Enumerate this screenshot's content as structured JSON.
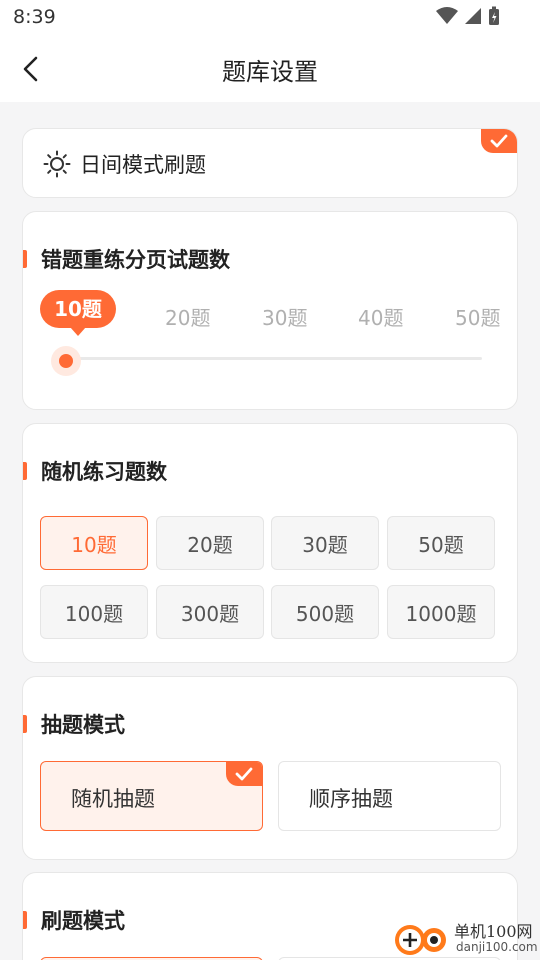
{
  "status": {
    "time": "8:39"
  },
  "header": {
    "title": "题库设置"
  },
  "day_mode": {
    "label": "日间模式刷题"
  },
  "wrong_page": {
    "title": "错题重练分页试题数",
    "options": [
      "10题",
      "20题",
      "30题",
      "40题",
      "50题"
    ],
    "selected": "10题"
  },
  "random_practice": {
    "title": "随机练习题数",
    "options": [
      "10题",
      "20题",
      "30题",
      "50题",
      "100题",
      "300题",
      "500题",
      "1000题"
    ],
    "selected": "10题"
  },
  "draw_mode": {
    "title": "抽题模式",
    "options": [
      "随机抽题",
      "顺序抽题"
    ],
    "selected": "随机抽题"
  },
  "brush_mode": {
    "title": "刷题模式"
  },
  "watermark": {
    "cn": "单机100网",
    "en": "danji100.com"
  },
  "colors": {
    "accent": "#ff6a35",
    "accent_light": "#fff2ec"
  }
}
